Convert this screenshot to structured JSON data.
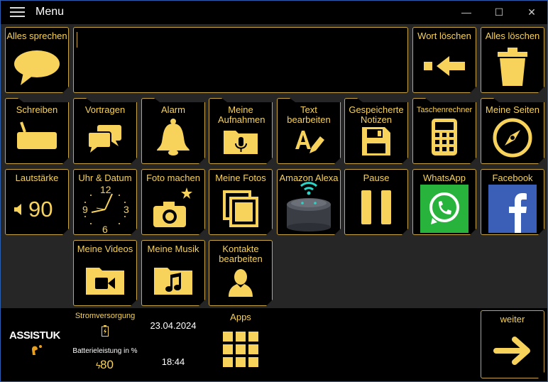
{
  "window": {
    "title": "Menu",
    "minimize": "—",
    "maximize": "☐",
    "close": "✕"
  },
  "colors": {
    "accent": "#f7d35c",
    "border": "#c9a640",
    "background": "#262626",
    "tile": "#000000"
  },
  "input": {
    "value": ""
  },
  "tiles": {
    "speak_all": "Alles sprechen",
    "delete_word": "Wort löschen",
    "delete_all": "Alles löschen",
    "write": "Schreiben",
    "present": "Vortragen",
    "alarm": "Alarm",
    "recordings": "Meine Aufnahmen",
    "edit_text": "Text bearbeiten",
    "saved_notes": "Gespeicherte Notizen",
    "calculator": "Taschenrechner",
    "my_pages": "Meine Seiten",
    "volume": "Lautstärke",
    "volume_value": "90",
    "clock": "Uhr & Datum",
    "clock_12": "12",
    "clock_3": "3",
    "clock_6": "6",
    "clock_9": "9",
    "photo": "Foto machen",
    "my_photos": "Meine Fotos",
    "alexa": "Amazon Alexa",
    "pause": "Pause",
    "whatsapp": "WhatsApp",
    "facebook": "Facebook",
    "my_videos": "Meine Videos",
    "my_music": "Meine Musik",
    "edit_contacts": "Kontakte bearbeiten"
  },
  "bottom": {
    "logo": "ASSISTUK",
    "power_label": "Stromversorgung",
    "battery_label": "Batterieleistung in %",
    "battery_value": "80",
    "date": "23.04.2024",
    "time": "18:44",
    "apps": "Apps",
    "next": "weiter"
  },
  "icons": [
    "hamburger-menu-icon",
    "speech-bubble-icon",
    "arrow-left-icon",
    "trash-icon",
    "keyboard-icon",
    "chat-bubbles-icon",
    "bell-icon",
    "microphone-folder-icon",
    "text-edit-icon",
    "floppy-disk-icon",
    "calculator-icon",
    "compass-icon",
    "speaker-icon",
    "clock-icon",
    "camera-icon",
    "photos-icon",
    "echo-speaker-icon",
    "pause-icon",
    "whatsapp-icon",
    "facebook-icon",
    "video-folder-icon",
    "music-folder-icon",
    "contact-icon",
    "battery-icon",
    "apps-grid-icon",
    "arrow-right-icon"
  ]
}
